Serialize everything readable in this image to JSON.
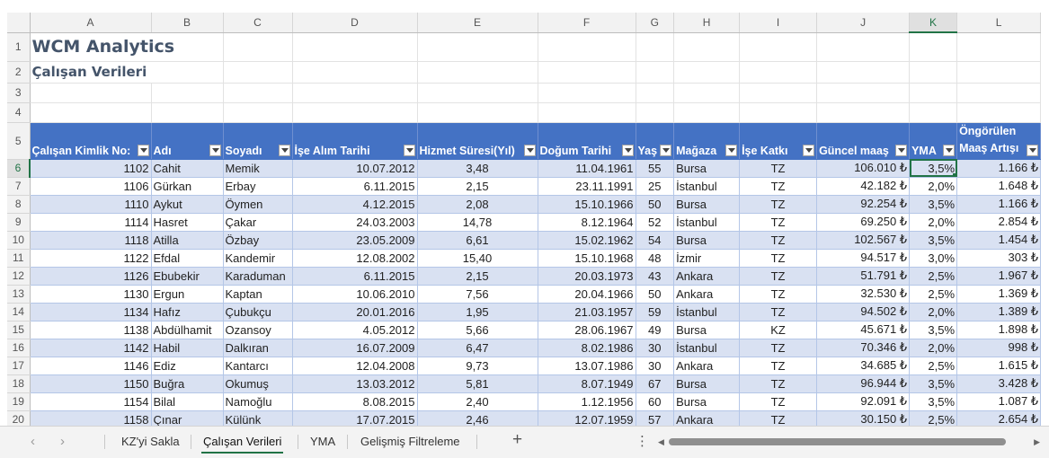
{
  "columns": [
    "A",
    "B",
    "C",
    "D",
    "E",
    "F",
    "G",
    "H",
    "I",
    "J",
    "K",
    "L"
  ],
  "selected_column": "K",
  "rows": {
    "title_row": "1",
    "subtitle_row": "2",
    "blank_rows": [
      "3",
      "4"
    ],
    "header_row": "5"
  },
  "title": "WCM Analytics",
  "subtitle": "Çalışan Verileri",
  "headers": {
    "id": "Çalışan Kimlik No:",
    "name": "Adı",
    "surname": "Soyadı",
    "hire": "İşe Alım Tarihi",
    "tenure": "Hizmet Süresi(Yıl)",
    "birth": "Doğum Tarihi",
    "age": "Yaş",
    "store": "Mağaza",
    "contribution": "İşe Katkı",
    "salary": "Güncel maaş",
    "yma": "YMA",
    "raise_line1": "Öngörülen",
    "raise_line2": "Maaş Artışı"
  },
  "data_rows": [
    {
      "row": "6",
      "id": "1102",
      "name": "Cahit",
      "surname": "Memik",
      "hire": "10.07.2012",
      "tenure": "3,48",
      "birth": "11.04.1961",
      "age": "55",
      "store": "Bursa",
      "contribution": "TZ",
      "salary": "106.010 ₺",
      "yma": "3,5%",
      "raise": "1.166 ₺"
    },
    {
      "row": "7",
      "id": "1106",
      "name": "Gürkan",
      "surname": "Erbay",
      "hire": "6.11.2015",
      "tenure": "2,15",
      "birth": "23.11.1991",
      "age": "25",
      "store": "İstanbul",
      "contribution": "TZ",
      "salary": "42.182 ₺",
      "yma": "2,0%",
      "raise": "1.648 ₺"
    },
    {
      "row": "8",
      "id": "1110",
      "name": "Aykut",
      "surname": "Öymen",
      "hire": "4.12.2015",
      "tenure": "2,08",
      "birth": "15.10.1966",
      "age": "50",
      "store": "Bursa",
      "contribution": "TZ",
      "salary": "92.254 ₺",
      "yma": "3,5%",
      "raise": "1.166 ₺"
    },
    {
      "row": "9",
      "id": "1114",
      "name": "Hasret",
      "surname": "Çakar",
      "hire": "24.03.2003",
      "tenure": "14,78",
      "birth": "8.12.1964",
      "age": "52",
      "store": "İstanbul",
      "contribution": "TZ",
      "salary": "69.250 ₺",
      "yma": "2,0%",
      "raise": "2.854 ₺"
    },
    {
      "row": "10",
      "id": "1118",
      "name": "Atilla",
      "surname": "Özbay",
      "hire": "23.05.2009",
      "tenure": "6,61",
      "birth": "15.02.1962",
      "age": "54",
      "store": "Bursa",
      "contribution": "TZ",
      "salary": "102.567 ₺",
      "yma": "3,5%",
      "raise": "1.454 ₺"
    },
    {
      "row": "11",
      "id": "1122",
      "name": "Efdal",
      "surname": "Kandemir",
      "hire": "12.08.2002",
      "tenure": "15,40",
      "birth": "15.10.1968",
      "age": "48",
      "store": "İzmir",
      "contribution": "TZ",
      "salary": "94.517 ₺",
      "yma": "3,0%",
      "raise": "303 ₺"
    },
    {
      "row": "12",
      "id": "1126",
      "name": "Ebubekir",
      "surname": "Karaduman",
      "hire": "6.11.2015",
      "tenure": "2,15",
      "birth": "20.03.1973",
      "age": "43",
      "store": "Ankara",
      "contribution": "TZ",
      "salary": "51.791 ₺",
      "yma": "2,5%",
      "raise": "1.967 ₺"
    },
    {
      "row": "13",
      "id": "1130",
      "name": "Ergun",
      "surname": "Kaptan",
      "hire": "10.06.2010",
      "tenure": "7,56",
      "birth": "20.04.1966",
      "age": "50",
      "store": "Ankara",
      "contribution": "TZ",
      "salary": "32.530 ₺",
      "yma": "2,5%",
      "raise": "1.369 ₺"
    },
    {
      "row": "14",
      "id": "1134",
      "name": "Hafız",
      "surname": "Çubukçu",
      "hire": "20.01.2016",
      "tenure": "1,95",
      "birth": "21.03.1957",
      "age": "59",
      "store": "İstanbul",
      "contribution": "TZ",
      "salary": "94.502 ₺",
      "yma": "2,0%",
      "raise": "1.389 ₺"
    },
    {
      "row": "15",
      "id": "1138",
      "name": "Abdülhamit",
      "surname": "Ozansoy",
      "hire": "4.05.2012",
      "tenure": "5,66",
      "birth": "28.06.1967",
      "age": "49",
      "store": "Bursa",
      "contribution": "KZ",
      "salary": "45.671 ₺",
      "yma": "3,5%",
      "raise": "1.898 ₺"
    },
    {
      "row": "16",
      "id": "1142",
      "name": "Habil",
      "surname": "Dalkıran",
      "hire": "16.07.2009",
      "tenure": "6,47",
      "birth": "8.02.1986",
      "age": "30",
      "store": "İstanbul",
      "contribution": "TZ",
      "salary": "70.346 ₺",
      "yma": "2,0%",
      "raise": "998 ₺"
    },
    {
      "row": "17",
      "id": "1146",
      "name": "Ediz",
      "surname": "Kantarcı",
      "hire": "12.04.2008",
      "tenure": "9,73",
      "birth": "13.07.1986",
      "age": "30",
      "store": "Ankara",
      "contribution": "TZ",
      "salary": "34.685 ₺",
      "yma": "2,5%",
      "raise": "1.615 ₺"
    },
    {
      "row": "18",
      "id": "1150",
      "name": "Buğra",
      "surname": "Okumuş",
      "hire": "13.03.2012",
      "tenure": "5,81",
      "birth": "8.07.1949",
      "age": "67",
      "store": "Bursa",
      "contribution": "TZ",
      "salary": "96.944 ₺",
      "yma": "3,5%",
      "raise": "3.428 ₺"
    },
    {
      "row": "19",
      "id": "1154",
      "name": "Bilal",
      "surname": "Namoğlu",
      "hire": "8.08.2015",
      "tenure": "2,40",
      "birth": "1.12.1956",
      "age": "60",
      "store": "Bursa",
      "contribution": "TZ",
      "salary": "92.091 ₺",
      "yma": "3,5%",
      "raise": "1.087 ₺"
    },
    {
      "row": "20",
      "id": "1158",
      "name": "Çınar",
      "surname": "Külünk",
      "hire": "17.07.2015",
      "tenure": "2,46",
      "birth": "12.07.1959",
      "age": "57",
      "store": "Ankara",
      "contribution": "TZ",
      "salary": "30.150 ₺",
      "yma": "2,5%",
      "raise": "2.654 ₺"
    }
  ],
  "active_cell_row": "6",
  "sheet_tabs": [
    "KZ'yi Sakla",
    "Çalışan Verileri",
    "YMA",
    "Gelişmiş Filtreleme"
  ],
  "active_tab": "Çalışan Verileri",
  "icons": {
    "prev": "chevron-left-icon",
    "next": "chevron-right-icon",
    "add": "plus-icon",
    "more": "more-vertical-icon"
  },
  "colors": {
    "header_fill": "#4472c4",
    "band_fill": "#d9e1f2",
    "title_color": "#44546a",
    "excel_green": "#217346"
  }
}
